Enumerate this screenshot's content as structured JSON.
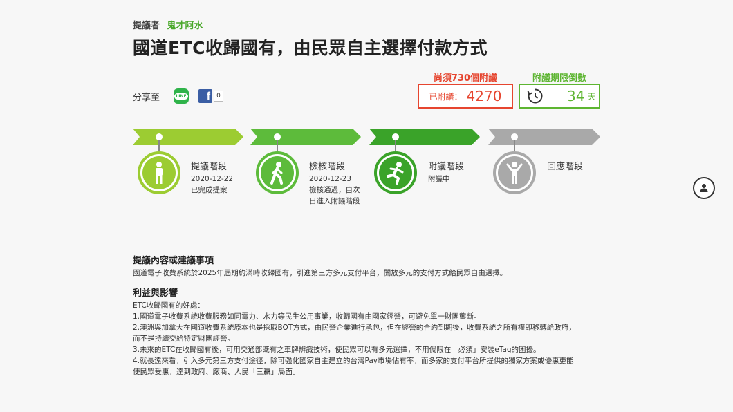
{
  "proposer": {
    "label": "提議者",
    "name": "鬼才阿水"
  },
  "title": "國道ETC收歸國有，由民眾自主選擇付款方式",
  "share": {
    "label": "分享至",
    "line_label": "LINE",
    "fb_count": "0"
  },
  "signatures": {
    "need_text": "尚須730個附議",
    "count_label": "已附議：",
    "count": "4270"
  },
  "deadline": {
    "title": "附議期限倒數",
    "days": "34",
    "unit": "天"
  },
  "colors": {
    "stage1": "#9ccc32",
    "stage2": "#5dbb3b",
    "stage3": "#3aa329",
    "stage4": "#a9a9a9",
    "alert": "#e6452f",
    "accent": "#5db531"
  },
  "stages": [
    {
      "name": "提議階段",
      "date": "2020-12-22",
      "status": "已完成提案",
      "icon": "standing-person-icon"
    },
    {
      "name": "檢核階段",
      "date": "2020-12-23",
      "status": "檢核通過，自次",
      "status2": "日進入附議階段",
      "icon": "walking-person-icon"
    },
    {
      "name": "附議階段",
      "status": "附議中",
      "icon": "running-person-icon"
    },
    {
      "name": "回應階段",
      "icon": "cheering-person-icon"
    }
  ],
  "content": {
    "heading": "提議內容或建議事項",
    "body": "國道電子收費系統於2025年屆期約滿時收歸國有，引進第三方多元支付平台，開放多元的支付方式給民眾自由選擇。"
  },
  "impact": {
    "heading": "利益與影響",
    "lines": [
      "ETC收歸國有的好處：",
      "1.國道電子收費系統收費服務如同電力、水力等民生公用事業，收歸國有由國家經營，可避免單一財團壟斷。",
      "2.澳洲與加拿大在國道收費系統原本也是採取BOT方式，由民營企業進行承包，但在經營的合約到期後，收費系統之所有權即移轉給政府，",
      "而不是持續交給特定財團經營。",
      "3.未來的ETC在收歸國有後，可用交通部既有之車牌辨識技術，使民眾可以有多元選擇，不用侷限在「必須」安裝eTag的困擾。",
      "4.就長遠來看，引入多元第三方支付途徑，除可強化國家自主建立的台灣Pay市場佔有率，而多家的支付平台所提供的獨家方案或優惠更能",
      "使民眾受惠，達到政府、廠商、人民「三贏」局面。"
    ]
  }
}
